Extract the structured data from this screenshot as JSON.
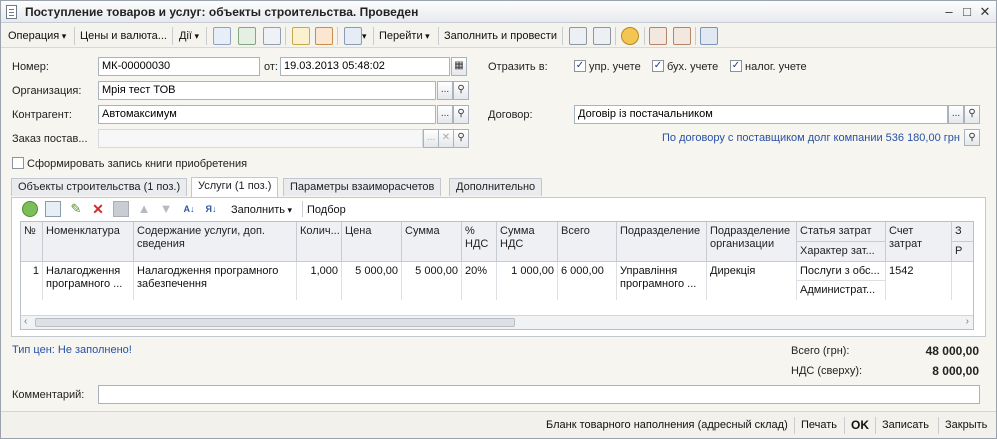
{
  "window": {
    "title": "Поступление товаров и услуг: объекты строительства. Проведен"
  },
  "toolbar": {
    "operation": "Операция",
    "prices": "Цены и валюта...",
    "actions": "Дії",
    "goto": "Перейти",
    "fill_post": "Заполнить и провести"
  },
  "header": {
    "number_label": "Номер:",
    "number_value": "МК-00000030",
    "date_label": "от:",
    "date_value": "19.03.2013 05:48:02",
    "org_label": "Организация:",
    "org_value": "Мрія тест ТОВ",
    "contractor_label": "Контрагент:",
    "contractor_value": "Автомаксимум",
    "order_label": "Заказ постав...",
    "order_value": "",
    "reflect_label": "Отразить в:",
    "chk_upr": "упр. учете",
    "chk_buh": "бух. учете",
    "chk_nalog": "налог. учете",
    "contract_label": "Договор:",
    "contract_value": "Договір із постачальником",
    "debt_text": "По договору с поставщиком долг компании 536 180,00 грн",
    "purchase_book": "Сформировать запись книги приобретения"
  },
  "tabs": [
    {
      "label": "Объекты строительства (1 поз.)"
    },
    {
      "label": "Услуги (1 поз.)"
    },
    {
      "label": "Параметры взаиморасчетов"
    },
    {
      "label": "Дополнительно"
    }
  ],
  "grid_toolbar": {
    "fill": "Заполнить",
    "pick": "Подбор"
  },
  "table": {
    "headers": {
      "num": "№",
      "nomen": "Номенклатура",
      "content": "Содержание услуги, доп. сведения",
      "qty": "Колич...",
      "price": "Цена",
      "sum": "Сумма",
      "vat_pct": "% НДС",
      "vat_sum": "Сумма НДС",
      "total": "Всего",
      "dept": "Подразделение",
      "org_dept": "Подразделение организации",
      "cost_item": "Статья затрат",
      "cost_char": "Характер зат...",
      "account": "Счет затрат",
      "extra1": "З",
      "extra2": "Р"
    },
    "row": {
      "num": "1",
      "nomen": "Налагодження програмного ...",
      "content": "Налагодження програмного забезпечення",
      "qty": "1,000",
      "price": "5 000,00",
      "sum": "5 000,00",
      "vat_pct": "20%",
      "vat_sum": "1 000,00",
      "total": "6 000,00",
      "dept": "Управління програмного ...",
      "org_dept": "Дирекція",
      "cost_item": "Послуги з обс...",
      "cost_char": "Администрат...",
      "account": "1542"
    }
  },
  "footer": {
    "price_type": "Тип цен: Не заполнено!",
    "total_label": "Всего (грн):",
    "total_value": "48 000,00",
    "vat_label": "НДС (сверху):",
    "vat_value": "8 000,00",
    "comment_label": "Комментарий:"
  },
  "bottom": {
    "blank": "Бланк товарного наполнения (адресный склад)",
    "print": "Печать",
    "ok": "OK",
    "save": "Записать",
    "close": "Закрыть"
  }
}
